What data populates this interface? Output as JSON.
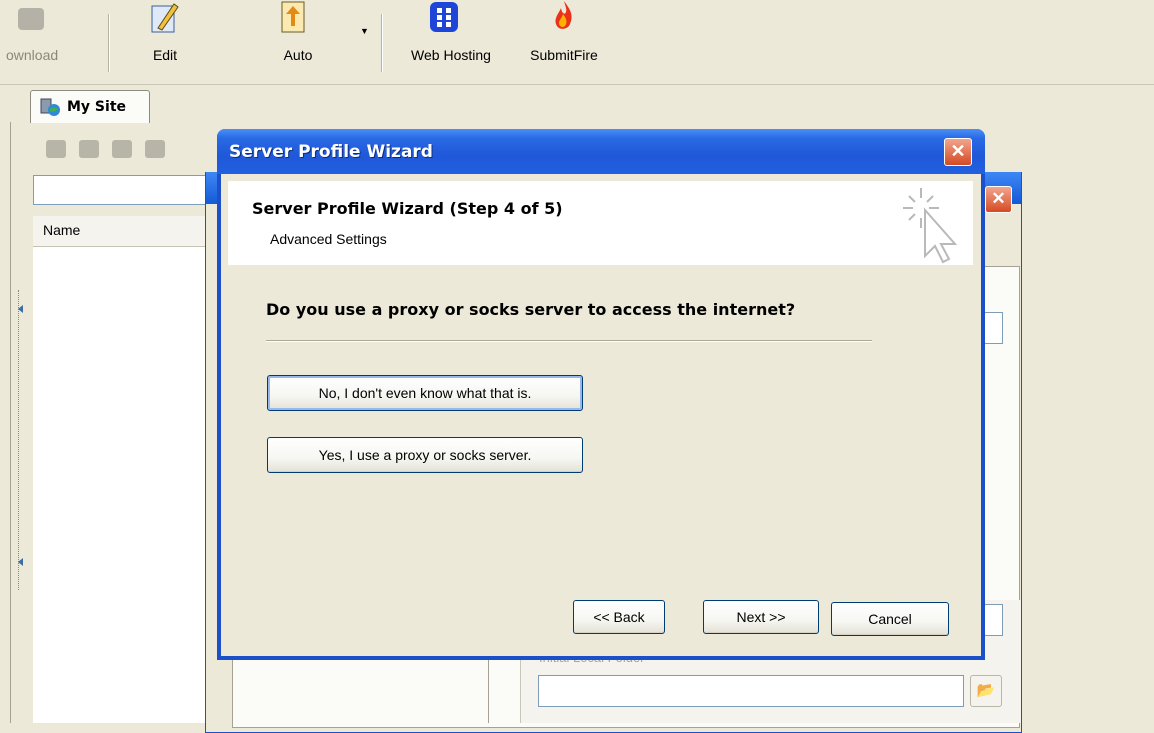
{
  "toolbar": {
    "download_label": "ownload",
    "edit_label": "Edit",
    "auto_label": "Auto",
    "webhosting_label": "Web Hosting",
    "submitfire_label": "SubmitFire"
  },
  "site_tab": {
    "label": "My Site"
  },
  "file_list": {
    "name_header": "Name"
  },
  "background_dialog": {
    "field_label": "Initial Local Folder"
  },
  "wizard": {
    "title": "Server Profile Wizard",
    "step_title": "Server Profile Wizard (Step 4 of 5)",
    "step_subtitle": "Advanced Settings",
    "question": "Do you use a proxy or socks server to access the internet?",
    "choice_no": "No, I don't even  know what that is.",
    "choice_yes": "Yes, I use a proxy or socks server.",
    "back_label": "<< Back",
    "next_label": "Next >>",
    "cancel_label": "Cancel",
    "close_glyph": "✕"
  },
  "icons": [
    "download-icon",
    "edit-pencil-icon",
    "auto-icon",
    "web-hosting-icon",
    "submitfire-flame-icon",
    "site-icon",
    "wizard-cursor-icon",
    "browse-folder-icon"
  ]
}
